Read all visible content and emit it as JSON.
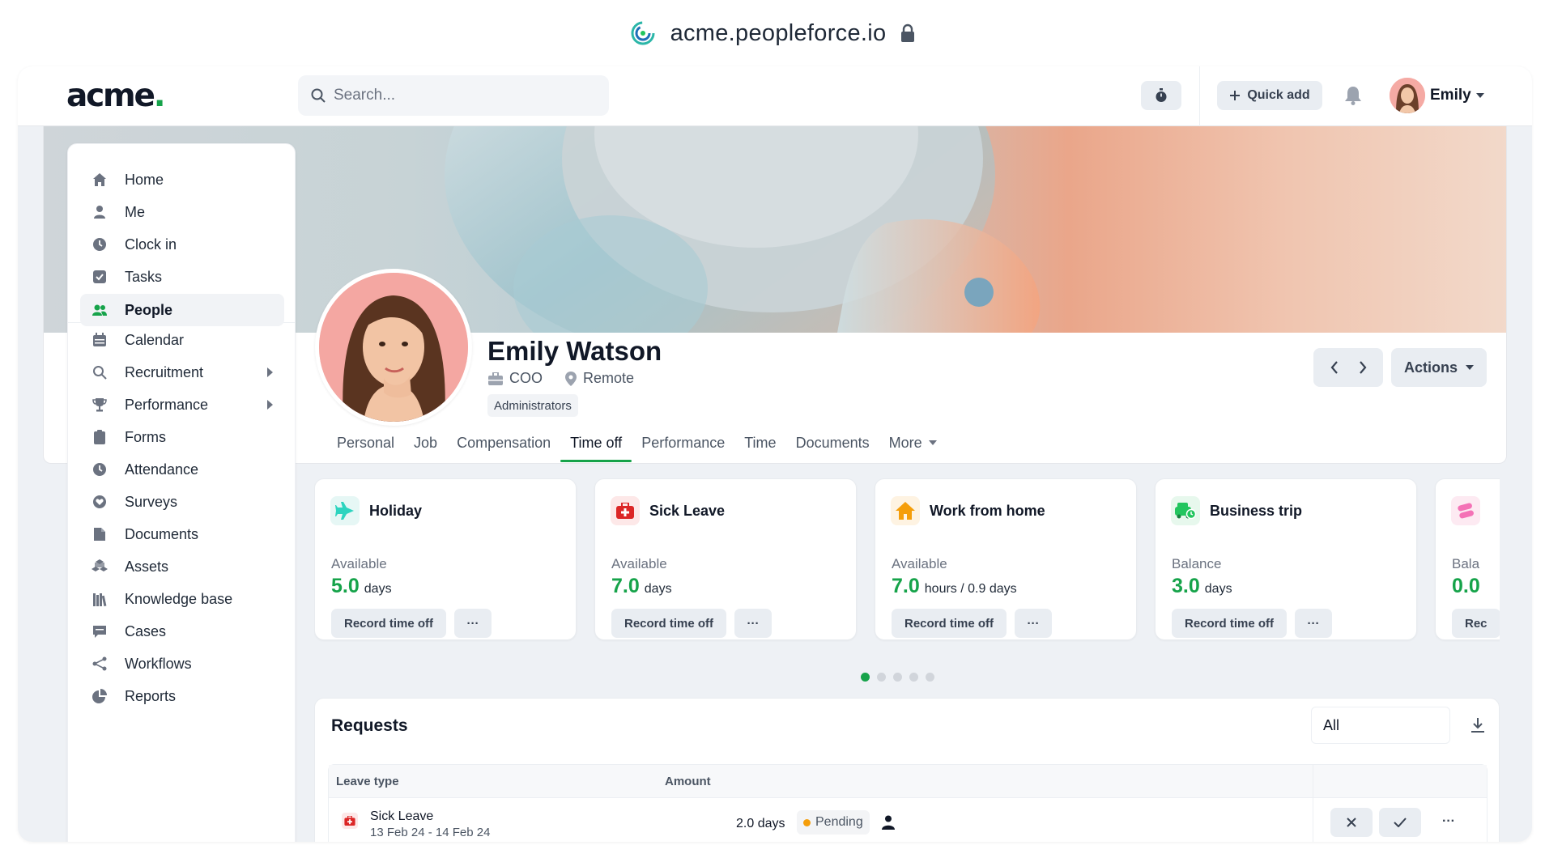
{
  "browser": {
    "url": "acme.peopleforce.io"
  },
  "topnav": {
    "logo_text": "acme",
    "logo_dot": ".",
    "search_placeholder": "Search...",
    "quick_add_label": "Quick add",
    "user_name": "Emily"
  },
  "sidebar": {
    "items": [
      {
        "label": "Home",
        "icon": "home-icon"
      },
      {
        "label": "Me",
        "icon": "user-icon"
      },
      {
        "label": "Clock in",
        "icon": "clock-icon"
      },
      {
        "label": "Tasks",
        "icon": "checkbox-icon"
      },
      {
        "label": "People",
        "icon": "people-icon",
        "active": true
      },
      {
        "label": "Calendar",
        "icon": "calendar-icon"
      },
      {
        "label": "Recruitment",
        "icon": "search-icon",
        "submenu": true
      },
      {
        "label": "Performance",
        "icon": "trophy-icon",
        "submenu": true
      },
      {
        "label": "Forms",
        "icon": "clipboard-icon"
      },
      {
        "label": "Attendance",
        "icon": "clock-icon"
      },
      {
        "label": "Surveys",
        "icon": "heart-icon"
      },
      {
        "label": "Documents",
        "icon": "document-icon"
      },
      {
        "label": "Assets",
        "icon": "assets-icon"
      },
      {
        "label": "Knowledge base",
        "icon": "library-icon"
      },
      {
        "label": "Cases",
        "icon": "chat-icon"
      },
      {
        "label": "Workflows",
        "icon": "workflow-icon"
      },
      {
        "label": "Reports",
        "icon": "pie-icon"
      }
    ]
  },
  "profile": {
    "name": "Emily Watson",
    "position": "COO",
    "location": "Remote",
    "role_badge": "Administrators",
    "actions_label": "Actions"
  },
  "tabs": [
    {
      "label": "Personal"
    },
    {
      "label": "Job"
    },
    {
      "label": "Compensation"
    },
    {
      "label": "Time off",
      "active": true
    },
    {
      "label": "Performance"
    },
    {
      "label": "Time"
    },
    {
      "label": "Documents"
    },
    {
      "label": "More",
      "dropdown": true
    }
  ],
  "leave_cards": [
    {
      "title": "Holiday",
      "label": "Available",
      "value": "5.0",
      "unit": "days",
      "button": "Record time off",
      "more": "···",
      "icon": "plane-icon",
      "color": "#2dd4bf"
    },
    {
      "title": "Sick Leave",
      "label": "Available",
      "value": "7.0",
      "unit": "days",
      "button": "Record time off",
      "more": "···",
      "icon": "medkit-icon",
      "color": "#dc2626"
    },
    {
      "title": "Work from home",
      "label": "Available",
      "value": "7.0",
      "unit": "hours / 0.9 days",
      "button": "Record time off",
      "more": "···",
      "icon": "house-icon",
      "color": "#f59e0b"
    },
    {
      "title": "Business trip",
      "label": "Balance",
      "value": "3.0",
      "unit": "days",
      "button": "Record time off",
      "more": "···",
      "icon": "car-icon",
      "color": "#22c55e"
    },
    {
      "title": "",
      "label": "Bala",
      "value": "0.0",
      "unit": "",
      "button": "Rec",
      "more": "",
      "icon": "pills-icon",
      "color": "#f472b6"
    }
  ],
  "carousel": {
    "pages": 5,
    "current": 1
  },
  "requests": {
    "title": "Requests",
    "filter_value": "All",
    "columns": {
      "leave_type": "Leave type",
      "amount": "Amount"
    },
    "rows": [
      {
        "leave_type": "Sick Leave",
        "dates": "13 Feb 24 - 14 Feb 24",
        "amount": "2.0 days",
        "status": "Pending",
        "row_more": "···"
      }
    ]
  },
  "colors": {
    "accent": "#16a34a",
    "pending": "#f59e0b"
  }
}
